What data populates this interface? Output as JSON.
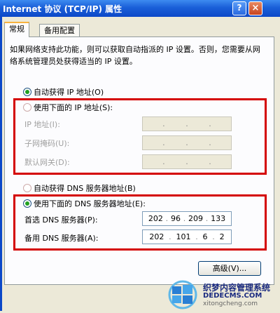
{
  "window": {
    "title": "Internet 协议 (TCP/IP) 属性",
    "help_glyph": "?",
    "close_glyph": "×"
  },
  "tabs": [
    {
      "label": "常规",
      "active": true
    },
    {
      "label": "备用配置",
      "active": false
    }
  ],
  "description": "如果网络支持此功能，则可以获取自动指派的 IP 设置。否则，您需要从网络系统管理员处获得适当的 IP 设置。",
  "ip_options": {
    "auto_label": "自动获得 IP 地址(O)",
    "manual_label": "使用下面的 IP 地址(S):",
    "selected": "auto"
  },
  "ip_fields": [
    {
      "label": "IP 地址(I):",
      "value": [
        "",
        "",
        "",
        ""
      ]
    },
    {
      "label": "子网掩码(U):",
      "value": [
        "",
        "",
        "",
        ""
      ]
    },
    {
      "label": "默认网关(D):",
      "value": [
        "",
        "",
        "",
        ""
      ]
    }
  ],
  "dns_options": {
    "auto_label": "自动获得 DNS 服务器地址(B)",
    "manual_label": "使用下面的 DNS 服务器地址(E):",
    "selected": "manual"
  },
  "dns_fields": [
    {
      "label": "首选 DNS 服务器(P):",
      "value": [
        "202",
        "96",
        "209",
        "133"
      ]
    },
    {
      "label": "备用 DNS 服务器(A):",
      "value": [
        "202",
        "101",
        "6",
        "2"
      ]
    }
  ],
  "advanced_button": "高级(V)...",
  "watermark": {
    "line1": "织梦内容管理系统",
    "line2": "DEDECMS.COM",
    "line3": "xitongcheng.com"
  },
  "colors": {
    "highlight_box": "#d40000",
    "title_bar": "#1a5fd8"
  }
}
